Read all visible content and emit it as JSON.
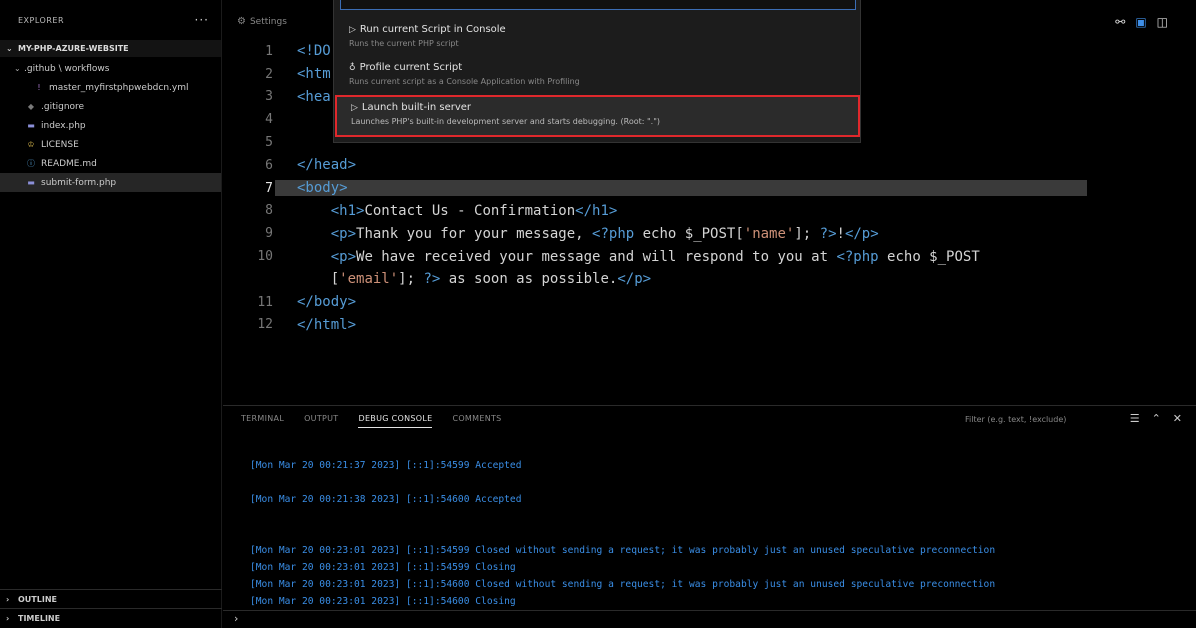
{
  "sidebar": {
    "title": "EXPLORER",
    "more": "···",
    "root": "MY-PHP-AZURE-WEBSITE",
    "items": [
      {
        "label": ".github \\ workflows",
        "icon": "folder-icon",
        "indent": 1,
        "chevron": "⌄"
      },
      {
        "label": "master_myfirstphpwebdcn.yml",
        "icon": "yaml-file-icon",
        "indent": 2,
        "chevron": ""
      },
      {
        "label": ".gitignore",
        "icon": "git-file-icon",
        "indent": 1,
        "chevron": ""
      },
      {
        "label": "index.php",
        "icon": "php-file-icon",
        "indent": 1,
        "chevron": ""
      },
      {
        "label": "LICENSE",
        "icon": "license-file-icon",
        "indent": 1,
        "chevron": ""
      },
      {
        "label": "README.md",
        "icon": "info-file-icon",
        "indent": 1,
        "chevron": ""
      },
      {
        "label": "submit-form.php",
        "icon": "php-file-icon",
        "indent": 1,
        "chevron": ""
      }
    ],
    "outline": "OUTLINE",
    "timeline": "TIMELINE"
  },
  "editor": {
    "tab_label": "Settings",
    "active_line": 7
  },
  "quickpick": {
    "items": [
      {
        "title": "Run current Script in Console",
        "desc": "Runs the current PHP script"
      },
      {
        "title": "Profile current Script",
        "desc": "Runs current script as a Console Application with Profiling"
      },
      {
        "title": "Launch built-in server",
        "desc": "Launches PHP's built-in development server and starts debugging. (Root: \".\")"
      }
    ]
  },
  "code_lines": [
    {
      "n": "1",
      "text": "<!DO"
    },
    {
      "n": "2",
      "text": "<htm"
    },
    {
      "n": "3",
      "text": "<hea"
    },
    {
      "n": "4",
      "text": ""
    },
    {
      "n": "5",
      "text": ""
    },
    {
      "n": "6",
      "text": "</head>"
    },
    {
      "n": "7",
      "text": "<body>"
    },
    {
      "n": "8",
      "text": "    <h1>Contact Us - Confirmation</h1>"
    },
    {
      "n": "9",
      "text": "    <p>Thank you for your message, <?php echo $_POST['name']; ?>!</p>"
    },
    {
      "n": "10",
      "text": "    <p>We have received your message and will respond to you at <?php echo $_POST"
    },
    {
      "n": "",
      "text": "    ['email']; ?> as soon as possible.</p>"
    },
    {
      "n": "11",
      "text": "</body>"
    },
    {
      "n": "12",
      "text": "</html>"
    }
  ],
  "panel": {
    "tabs": [
      "TERMINAL",
      "OUTPUT",
      "DEBUG CONSOLE",
      "COMMENTS"
    ],
    "active_tab": "DEBUG CONSOLE",
    "filter_placeholder": "Filter (e.g. text, !exclude)",
    "console_lines": [
      "[Mon Mar 20 00:21:37 2023] [::1]:54599 Accepted",
      "",
      "[Mon Mar 20 00:21:38 2023] [::1]:54600 Accepted",
      "",
      "",
      "[Mon Mar 20 00:23:01 2023] [::1]:54599 Closed without sending a request; it was probably just an unused speculative preconnection",
      "[Mon Mar 20 00:23:01 2023] [::1]:54599 Closing",
      "[Mon Mar 20 00:23:01 2023] [::1]:54600 Closed without sending a request; it was probably just an unused speculative preconnection",
      "[Mon Mar 20 00:23:01 2023] [::1]:54600 Closing"
    ],
    "prompt": "›"
  },
  "colors": {
    "accent_blue": "#3a8ee6",
    "highlight_red": "#e0282c",
    "tag_blue": "#569cd6",
    "string_orange": "#ce9178"
  }
}
